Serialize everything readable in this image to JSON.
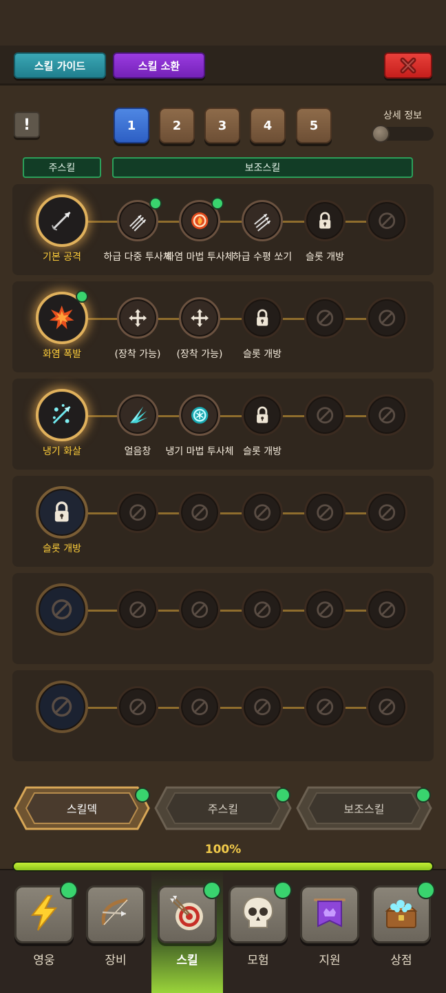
{
  "header": {
    "skill_guide_label": "스킬 가이드",
    "skill_summon_label": "스킬 소환",
    "close_icon": "close-x-icon"
  },
  "controls": {
    "info_label": "!",
    "deck_tabs": [
      "1",
      "2",
      "3",
      "4",
      "5"
    ],
    "active_deck": "1",
    "detail_info_label": "상세 정보",
    "detail_info_on": false
  },
  "section_labels": {
    "main": "주스킬",
    "sub": "보조스킬"
  },
  "rows": [
    {
      "main": {
        "label": "기본 공격",
        "icon": "arrow-icon",
        "state": "equipped",
        "dot": false
      },
      "subs": [
        {
          "label": "하급 다중 투사체",
          "icon": "multi-arrow-icon",
          "state": "equipped",
          "dot": true
        },
        {
          "label": "화염 마법 투사체",
          "icon": "fire-projectile-icon",
          "state": "equipped",
          "dot": true
        },
        {
          "label": "하급 수평 쏘기",
          "icon": "horizontal-arrows-icon",
          "state": "equipped",
          "dot": false
        },
        {
          "label": "슬롯 개방",
          "icon": "lock-icon",
          "state": "locked",
          "dot": false
        },
        {
          "label": "",
          "icon": "prohibited-icon",
          "state": "empty",
          "dot": false
        }
      ]
    },
    {
      "main": {
        "label": "화염 폭발",
        "icon": "fire-explosion-icon",
        "state": "equipped",
        "dot": true
      },
      "subs": [
        {
          "label": "(장착 가능)",
          "icon": "equip-cross-icon",
          "state": "equipable",
          "dot": false
        },
        {
          "label": "(장착 가능)",
          "icon": "equip-cross-icon",
          "state": "equipable",
          "dot": false
        },
        {
          "label": "슬롯 개방",
          "icon": "lock-icon",
          "state": "locked",
          "dot": false
        },
        {
          "label": "",
          "icon": "prohibited-icon",
          "state": "empty",
          "dot": false
        },
        {
          "label": "",
          "icon": "prohibited-icon",
          "state": "empty",
          "dot": false
        }
      ]
    },
    {
      "main": {
        "label": "냉기 화살",
        "icon": "frost-arrow-icon",
        "state": "equipped",
        "dot": false
      },
      "subs": [
        {
          "label": "얼음창",
          "icon": "ice-spear-icon",
          "state": "equipped",
          "dot": false
        },
        {
          "label": "냉기 마법 투사체",
          "icon": "frost-projectile-icon",
          "state": "equipped",
          "dot": false
        },
        {
          "label": "슬롯 개방",
          "icon": "lock-icon",
          "state": "locked",
          "dot": false
        },
        {
          "label": "",
          "icon": "prohibited-icon",
          "state": "empty",
          "dot": false
        },
        {
          "label": "",
          "icon": "prohibited-icon",
          "state": "empty",
          "dot": false
        }
      ]
    },
    {
      "main": {
        "label": "슬롯 개방",
        "icon": "lock-icon",
        "state": "locked",
        "dot": false
      },
      "subs": [
        {
          "label": "",
          "icon": "prohibited-icon",
          "state": "empty",
          "dot": false
        },
        {
          "label": "",
          "icon": "prohibited-icon",
          "state": "empty",
          "dot": false
        },
        {
          "label": "",
          "icon": "prohibited-icon",
          "state": "empty",
          "dot": false
        },
        {
          "label": "",
          "icon": "prohibited-icon",
          "state": "empty",
          "dot": false
        },
        {
          "label": "",
          "icon": "prohibited-icon",
          "state": "empty",
          "dot": false
        }
      ]
    },
    {
      "main": {
        "label": "",
        "icon": "prohibited-icon",
        "state": "empty",
        "dot": false
      },
      "subs": [
        {
          "label": "",
          "icon": "prohibited-icon",
          "state": "empty",
          "dot": false
        },
        {
          "label": "",
          "icon": "prohibited-icon",
          "state": "empty",
          "dot": false
        },
        {
          "label": "",
          "icon": "prohibited-icon",
          "state": "empty",
          "dot": false
        },
        {
          "label": "",
          "icon": "prohibited-icon",
          "state": "empty",
          "dot": false
        },
        {
          "label": "",
          "icon": "prohibited-icon",
          "state": "empty",
          "dot": false
        }
      ]
    },
    {
      "main": {
        "label": "",
        "icon": "prohibited-icon",
        "state": "empty",
        "dot": false
      },
      "subs": [
        {
          "label": "",
          "icon": "prohibited-icon",
          "state": "empty",
          "dot": false
        },
        {
          "label": "",
          "icon": "prohibited-icon",
          "state": "empty",
          "dot": false
        },
        {
          "label": "",
          "icon": "prohibited-icon",
          "state": "empty",
          "dot": false
        },
        {
          "label": "",
          "icon": "prohibited-icon",
          "state": "empty",
          "dot": false
        },
        {
          "label": "",
          "icon": "prohibited-icon",
          "state": "empty",
          "dot": false
        }
      ]
    }
  ],
  "bottom_tabs": [
    {
      "label": "스킬덱",
      "active": true,
      "dot": true
    },
    {
      "label": "주스킬",
      "active": false,
      "dot": true
    },
    {
      "label": "보조스킬",
      "active": false,
      "dot": true
    }
  ],
  "progress": {
    "label": "100%",
    "value": 1.0
  },
  "nav": [
    {
      "label": "영웅",
      "icon": "lightning-icon",
      "active": false,
      "dot": true
    },
    {
      "label": "장비",
      "icon": "bow-icon",
      "active": false,
      "dot": false
    },
    {
      "label": "스킬",
      "icon": "target-arrows-icon",
      "active": true,
      "dot": true
    },
    {
      "label": "모험",
      "icon": "skull-icon",
      "active": false,
      "dot": true
    },
    {
      "label": "지원",
      "icon": "banner-icon",
      "active": false,
      "dot": false
    },
    {
      "label": "상점",
      "icon": "treasure-chest-icon",
      "active": false,
      "dot": true
    }
  ],
  "colors": {
    "accent_gold": "#ffcf3b",
    "notification_green": "#39d46e",
    "progress_green": "#b5e32d",
    "active_tab_blue": "#3d72d6"
  }
}
